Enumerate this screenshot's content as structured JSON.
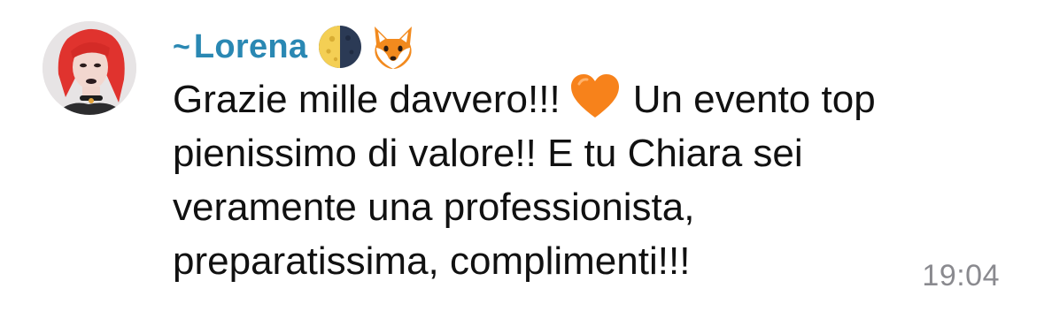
{
  "message": {
    "sender": {
      "tilde": "~",
      "name": "Lorena",
      "name_color": "#2a88b3",
      "emojis": [
        "moon-icon",
        "fox-icon"
      ]
    },
    "avatar": "avatar",
    "text_lines": [
      "Grazie mille davvero!!!",
      "Un evento top",
      "pienissimo di valore!! E tu Chiara sei",
      "veramente una professionista,",
      "preparatissima, complimenti!!!"
    ],
    "inline_emoji": "orange-heart-icon",
    "timestamp": "19:04",
    "timestamp_color": "#8a8a8f"
  }
}
